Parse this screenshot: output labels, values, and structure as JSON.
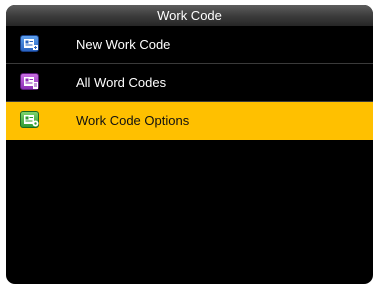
{
  "title": "Work Code",
  "menu": {
    "items": [
      {
        "label": "New Work Code",
        "icon": "new-work-code-icon",
        "color": "#2a63c0",
        "selected": false
      },
      {
        "label": "All Word Codes",
        "icon": "all-work-codes-icon",
        "color": "#8b2fb6",
        "selected": false
      },
      {
        "label": "Work Code Options",
        "icon": "work-code-options-icon",
        "color": "#2f9b35",
        "selected": true
      }
    ]
  },
  "colors": {
    "selection": "#ffc000",
    "background": "#000000"
  }
}
